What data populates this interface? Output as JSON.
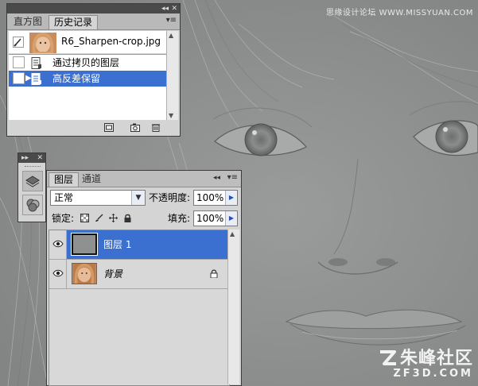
{
  "watermark": {
    "top_text": "思缘设计论坛 WWW.MISSYUAN.COM",
    "logo_text": "朱峰社区",
    "logo_sub": "ZF3D.COM"
  },
  "history_panel": {
    "tabs": [
      "直方图",
      "历史记录"
    ],
    "active_tab": 1,
    "snapshot": {
      "label": "R6_Sharpen-crop.jpg"
    },
    "items": [
      {
        "label": "通过拷贝的图层",
        "selected": false
      },
      {
        "label": "高反差保留",
        "selected": true
      }
    ],
    "footer_icons": [
      "new-document-from-state-icon",
      "new-snapshot-icon",
      "trash-icon"
    ]
  },
  "tool_strip": {
    "icons": [
      "layers-stack-icon",
      "channels-circles-icon"
    ]
  },
  "layers_panel": {
    "tabs": [
      "图层",
      "通道"
    ],
    "active_tab": 0,
    "blend_mode": "正常",
    "opacity_label": "不透明度:",
    "opacity_value": "100%",
    "lock_label": "锁定:",
    "lock_icons": [
      "lock-transparent-icon",
      "lock-brush-icon",
      "lock-move-icon",
      "lock-all-icon"
    ],
    "fill_label": "填充:",
    "fill_value": "100%",
    "layers": [
      {
        "name": "图层 1",
        "selected": true,
        "visible": true,
        "locked": false
      },
      {
        "name": "背景",
        "selected": false,
        "visible": true,
        "locked": true
      }
    ]
  },
  "colors": {
    "selection": "#3b6fd0",
    "panel": "#d4d4d4",
    "panel_titlebar": "#4a4a4a",
    "background_gray": "#8f9190"
  }
}
